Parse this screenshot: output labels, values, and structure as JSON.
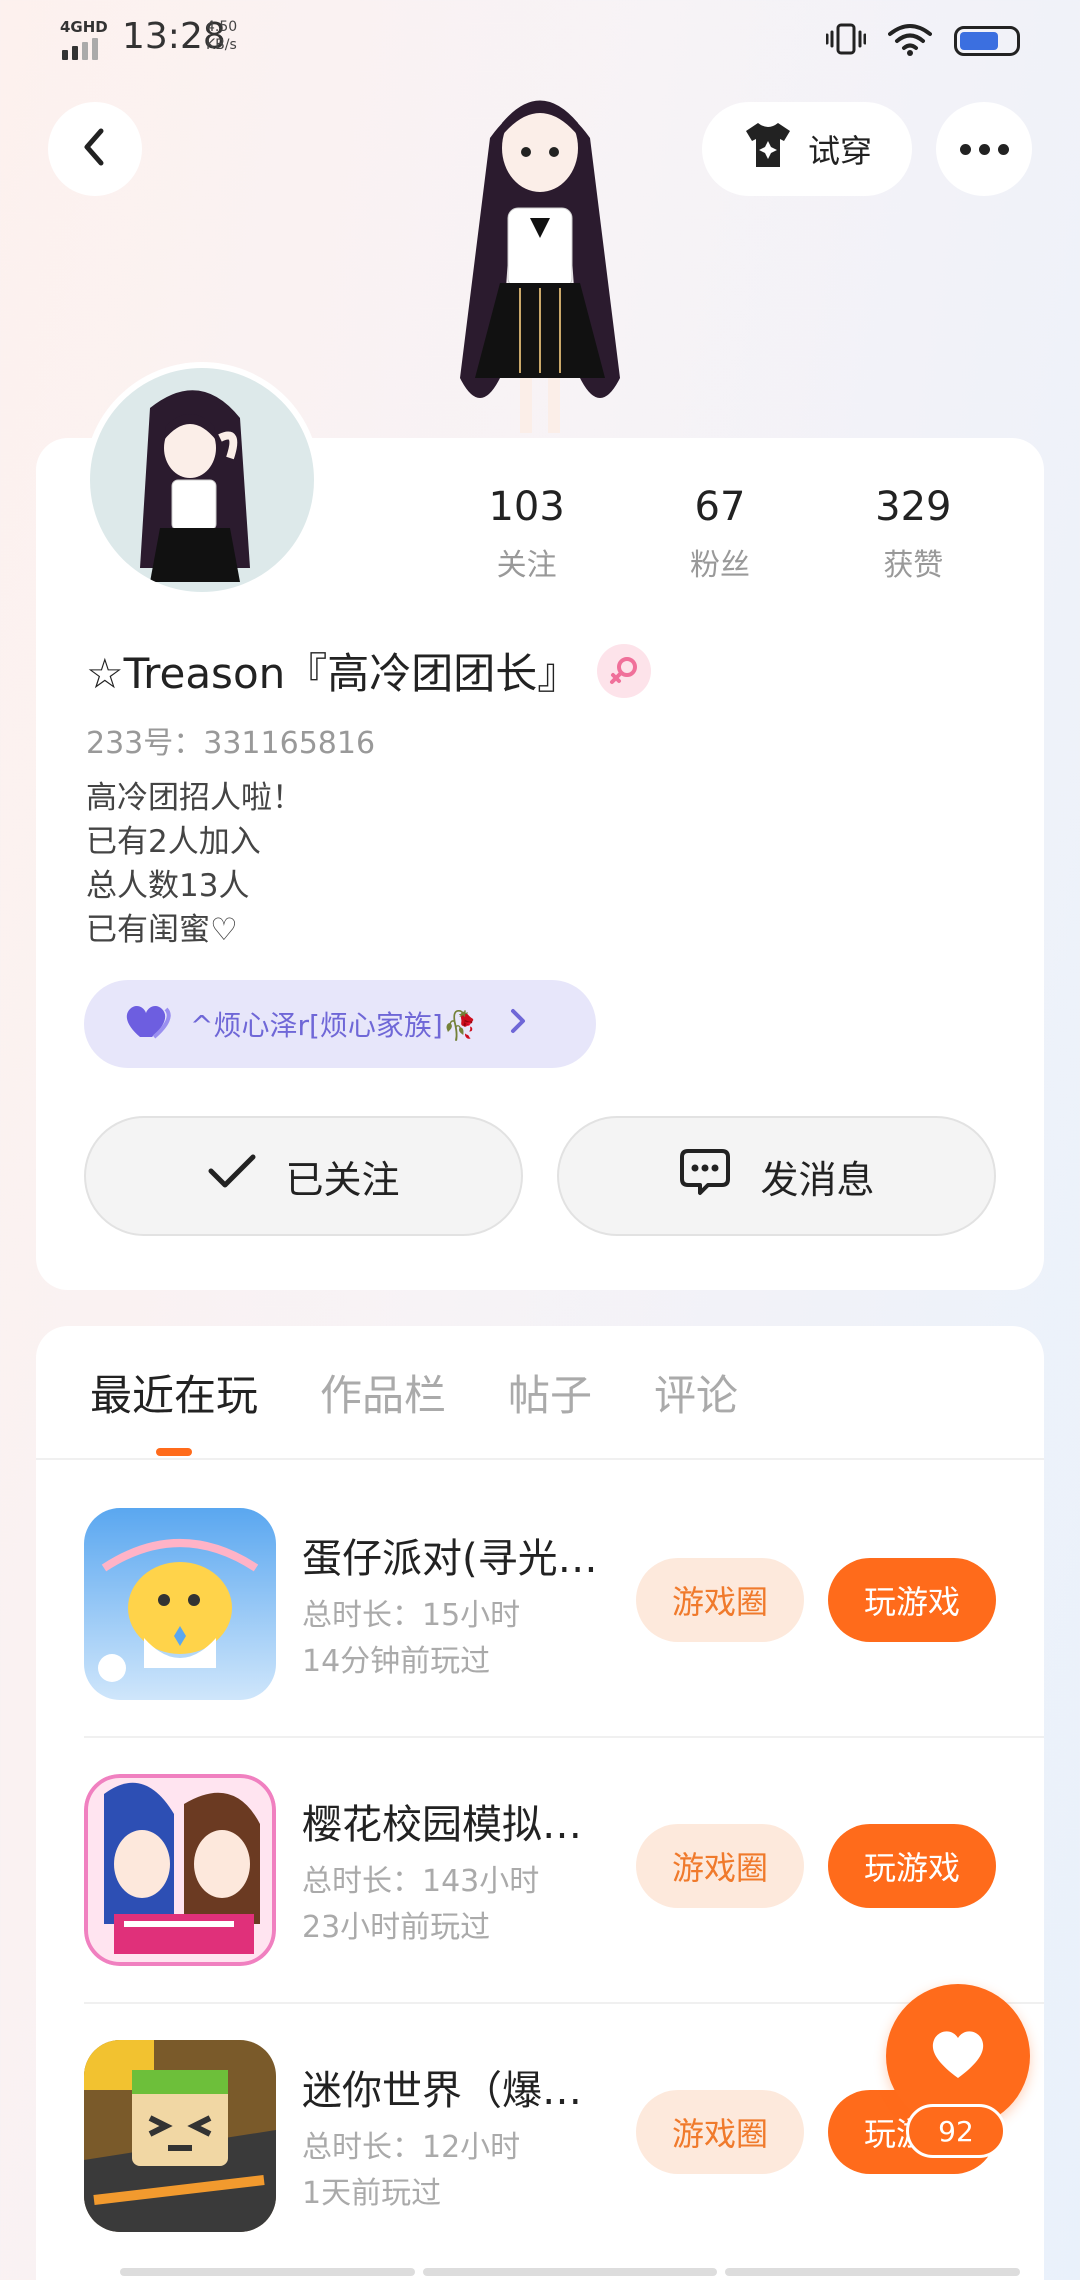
{
  "status_bar": {
    "network": "4GHD",
    "time": "13:28",
    "speed_value": "4.50",
    "speed_unit": "KB/s",
    "battery_level": 0.7
  },
  "header": {
    "try_on_label": "试穿"
  },
  "profile": {
    "stats": [
      {
        "value": "103",
        "label": "关注"
      },
      {
        "value": "67",
        "label": "粉丝"
      },
      {
        "value": "329",
        "label": "获赞"
      }
    ],
    "nickname": "☆Treason『高冷团团长』",
    "uid": "233号：331165816",
    "bio": [
      "高冷团招人啦！",
      "已有2人加入",
      "总人数13人",
      "已有闺蜜♡"
    ],
    "family_chip": "^烦心泽r[烦心家族]🥀",
    "follow_label": "已关注",
    "message_label": "发消息"
  },
  "tabs": [
    "最近在玩",
    "作品栏",
    "帖子",
    "评论"
  ],
  "games": [
    {
      "title": "蛋仔派对(寻光…",
      "total": "总时长：15小时",
      "last": "14分钟前玩过",
      "circle": "游戏圈",
      "play": "玩游戏"
    },
    {
      "title": "樱花校园模拟…",
      "total": "总时长：143小时",
      "last": "23小时前玩过",
      "circle": "游戏圈",
      "play": "玩游戏"
    },
    {
      "title": "迷你世界（爆…",
      "total": "总时长：12小时",
      "last": "1天前玩过",
      "circle": "游戏圈",
      "play": "玩游戏"
    }
  ],
  "like_count": "92",
  "colors": {
    "accent": "#ff6b1b",
    "family_chip_bg": "#e7e6fa",
    "family_chip_text": "#6f67d7"
  }
}
